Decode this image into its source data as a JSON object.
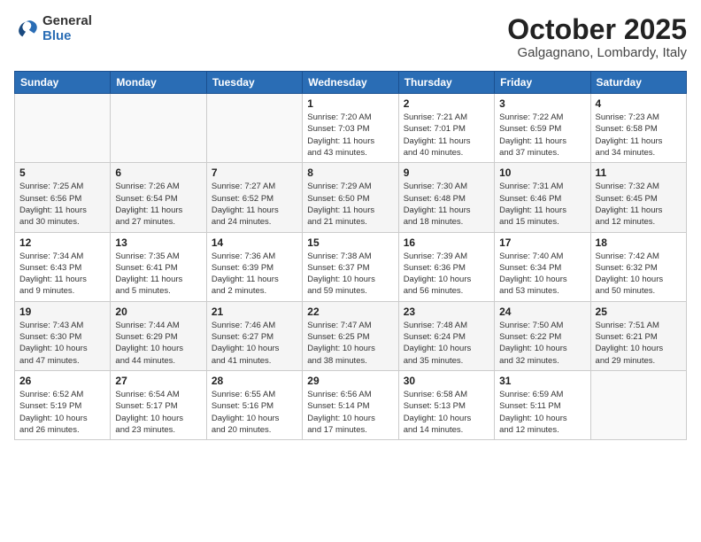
{
  "header": {
    "logo_line1": "General",
    "logo_line2": "Blue",
    "month": "October 2025",
    "location": "Galgagnano, Lombardy, Italy"
  },
  "weekdays": [
    "Sunday",
    "Monday",
    "Tuesday",
    "Wednesday",
    "Thursday",
    "Friday",
    "Saturday"
  ],
  "weeks": [
    [
      {
        "day": "",
        "detail": ""
      },
      {
        "day": "",
        "detail": ""
      },
      {
        "day": "",
        "detail": ""
      },
      {
        "day": "1",
        "detail": "Sunrise: 7:20 AM\nSunset: 7:03 PM\nDaylight: 11 hours\nand 43 minutes."
      },
      {
        "day": "2",
        "detail": "Sunrise: 7:21 AM\nSunset: 7:01 PM\nDaylight: 11 hours\nand 40 minutes."
      },
      {
        "day": "3",
        "detail": "Sunrise: 7:22 AM\nSunset: 6:59 PM\nDaylight: 11 hours\nand 37 minutes."
      },
      {
        "day": "4",
        "detail": "Sunrise: 7:23 AM\nSunset: 6:58 PM\nDaylight: 11 hours\nand 34 minutes."
      }
    ],
    [
      {
        "day": "5",
        "detail": "Sunrise: 7:25 AM\nSunset: 6:56 PM\nDaylight: 11 hours\nand 30 minutes."
      },
      {
        "day": "6",
        "detail": "Sunrise: 7:26 AM\nSunset: 6:54 PM\nDaylight: 11 hours\nand 27 minutes."
      },
      {
        "day": "7",
        "detail": "Sunrise: 7:27 AM\nSunset: 6:52 PM\nDaylight: 11 hours\nand 24 minutes."
      },
      {
        "day": "8",
        "detail": "Sunrise: 7:29 AM\nSunset: 6:50 PM\nDaylight: 11 hours\nand 21 minutes."
      },
      {
        "day": "9",
        "detail": "Sunrise: 7:30 AM\nSunset: 6:48 PM\nDaylight: 11 hours\nand 18 minutes."
      },
      {
        "day": "10",
        "detail": "Sunrise: 7:31 AM\nSunset: 6:46 PM\nDaylight: 11 hours\nand 15 minutes."
      },
      {
        "day": "11",
        "detail": "Sunrise: 7:32 AM\nSunset: 6:45 PM\nDaylight: 11 hours\nand 12 minutes."
      }
    ],
    [
      {
        "day": "12",
        "detail": "Sunrise: 7:34 AM\nSunset: 6:43 PM\nDaylight: 11 hours\nand 9 minutes."
      },
      {
        "day": "13",
        "detail": "Sunrise: 7:35 AM\nSunset: 6:41 PM\nDaylight: 11 hours\nand 5 minutes."
      },
      {
        "day": "14",
        "detail": "Sunrise: 7:36 AM\nSunset: 6:39 PM\nDaylight: 11 hours\nand 2 minutes."
      },
      {
        "day": "15",
        "detail": "Sunrise: 7:38 AM\nSunset: 6:37 PM\nDaylight: 10 hours\nand 59 minutes."
      },
      {
        "day": "16",
        "detail": "Sunrise: 7:39 AM\nSunset: 6:36 PM\nDaylight: 10 hours\nand 56 minutes."
      },
      {
        "day": "17",
        "detail": "Sunrise: 7:40 AM\nSunset: 6:34 PM\nDaylight: 10 hours\nand 53 minutes."
      },
      {
        "day": "18",
        "detail": "Sunrise: 7:42 AM\nSunset: 6:32 PM\nDaylight: 10 hours\nand 50 minutes."
      }
    ],
    [
      {
        "day": "19",
        "detail": "Sunrise: 7:43 AM\nSunset: 6:30 PM\nDaylight: 10 hours\nand 47 minutes."
      },
      {
        "day": "20",
        "detail": "Sunrise: 7:44 AM\nSunset: 6:29 PM\nDaylight: 10 hours\nand 44 minutes."
      },
      {
        "day": "21",
        "detail": "Sunrise: 7:46 AM\nSunset: 6:27 PM\nDaylight: 10 hours\nand 41 minutes."
      },
      {
        "day": "22",
        "detail": "Sunrise: 7:47 AM\nSunset: 6:25 PM\nDaylight: 10 hours\nand 38 minutes."
      },
      {
        "day": "23",
        "detail": "Sunrise: 7:48 AM\nSunset: 6:24 PM\nDaylight: 10 hours\nand 35 minutes."
      },
      {
        "day": "24",
        "detail": "Sunrise: 7:50 AM\nSunset: 6:22 PM\nDaylight: 10 hours\nand 32 minutes."
      },
      {
        "day": "25",
        "detail": "Sunrise: 7:51 AM\nSunset: 6:21 PM\nDaylight: 10 hours\nand 29 minutes."
      }
    ],
    [
      {
        "day": "26",
        "detail": "Sunrise: 6:52 AM\nSunset: 5:19 PM\nDaylight: 10 hours\nand 26 minutes."
      },
      {
        "day": "27",
        "detail": "Sunrise: 6:54 AM\nSunset: 5:17 PM\nDaylight: 10 hours\nand 23 minutes."
      },
      {
        "day": "28",
        "detail": "Sunrise: 6:55 AM\nSunset: 5:16 PM\nDaylight: 10 hours\nand 20 minutes."
      },
      {
        "day": "29",
        "detail": "Sunrise: 6:56 AM\nSunset: 5:14 PM\nDaylight: 10 hours\nand 17 minutes."
      },
      {
        "day": "30",
        "detail": "Sunrise: 6:58 AM\nSunset: 5:13 PM\nDaylight: 10 hours\nand 14 minutes."
      },
      {
        "day": "31",
        "detail": "Sunrise: 6:59 AM\nSunset: 5:11 PM\nDaylight: 10 hours\nand 12 minutes."
      },
      {
        "day": "",
        "detail": ""
      }
    ]
  ]
}
